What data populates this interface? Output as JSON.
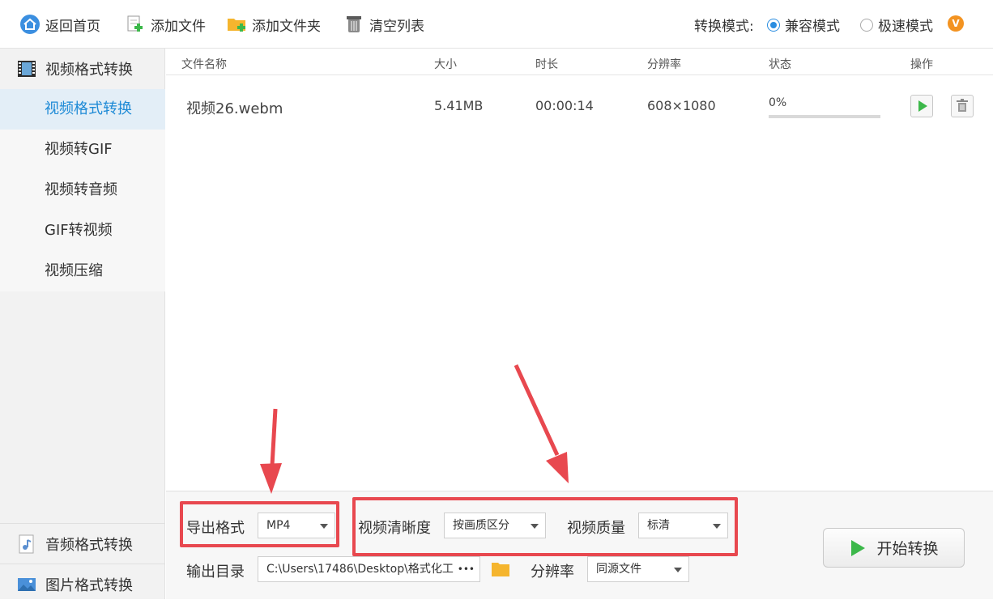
{
  "toolbar": {
    "home": "返回首页",
    "add_file": "添加文件",
    "add_folder": "添加文件夹",
    "clear_list": "清空列表",
    "mode_label": "转换模式:",
    "mode_compatible": "兼容模式",
    "mode_fast": "极速模式",
    "vip_badge": "V"
  },
  "sidebar": {
    "video_header": "视频格式转换",
    "items": [
      {
        "label": "视频格式转换",
        "active": true
      },
      {
        "label": "视频转GIF",
        "active": false
      },
      {
        "label": "视频转音频",
        "active": false
      },
      {
        "label": "GIF转视频",
        "active": false
      },
      {
        "label": "视频压缩",
        "active": false
      }
    ],
    "audio_header": "音频格式转换",
    "image_header": "图片格式转换"
  },
  "table": {
    "headers": {
      "name": "文件名称",
      "size": "大小",
      "duration": "时长",
      "resolution": "分辨率",
      "status": "状态",
      "actions": "操作"
    },
    "rows": [
      {
        "name": "视频26.webm",
        "size": "5.41MB",
        "duration": "00:00:14",
        "resolution": "608×1080",
        "status": "0%"
      }
    ]
  },
  "bottom": {
    "export_format_label": "导出格式",
    "export_format_value": "MP4",
    "clarity_label": "视频清晰度",
    "clarity_value": "按画质区分",
    "quality_label": "视频质量",
    "quality_value": "标清",
    "output_dir_label": "输出目录",
    "output_dir_value": "C:\\Users\\17486\\Desktop\\格式化工",
    "more": "•••",
    "resolution_label": "分辨率",
    "resolution_value": "同源文件",
    "start_button": "开始转换"
  },
  "colors": {
    "accent": "#1e8ad6",
    "annotation_red": "#e8484f",
    "play_green": "#3cb84a",
    "vip_orange": "#f39321"
  }
}
